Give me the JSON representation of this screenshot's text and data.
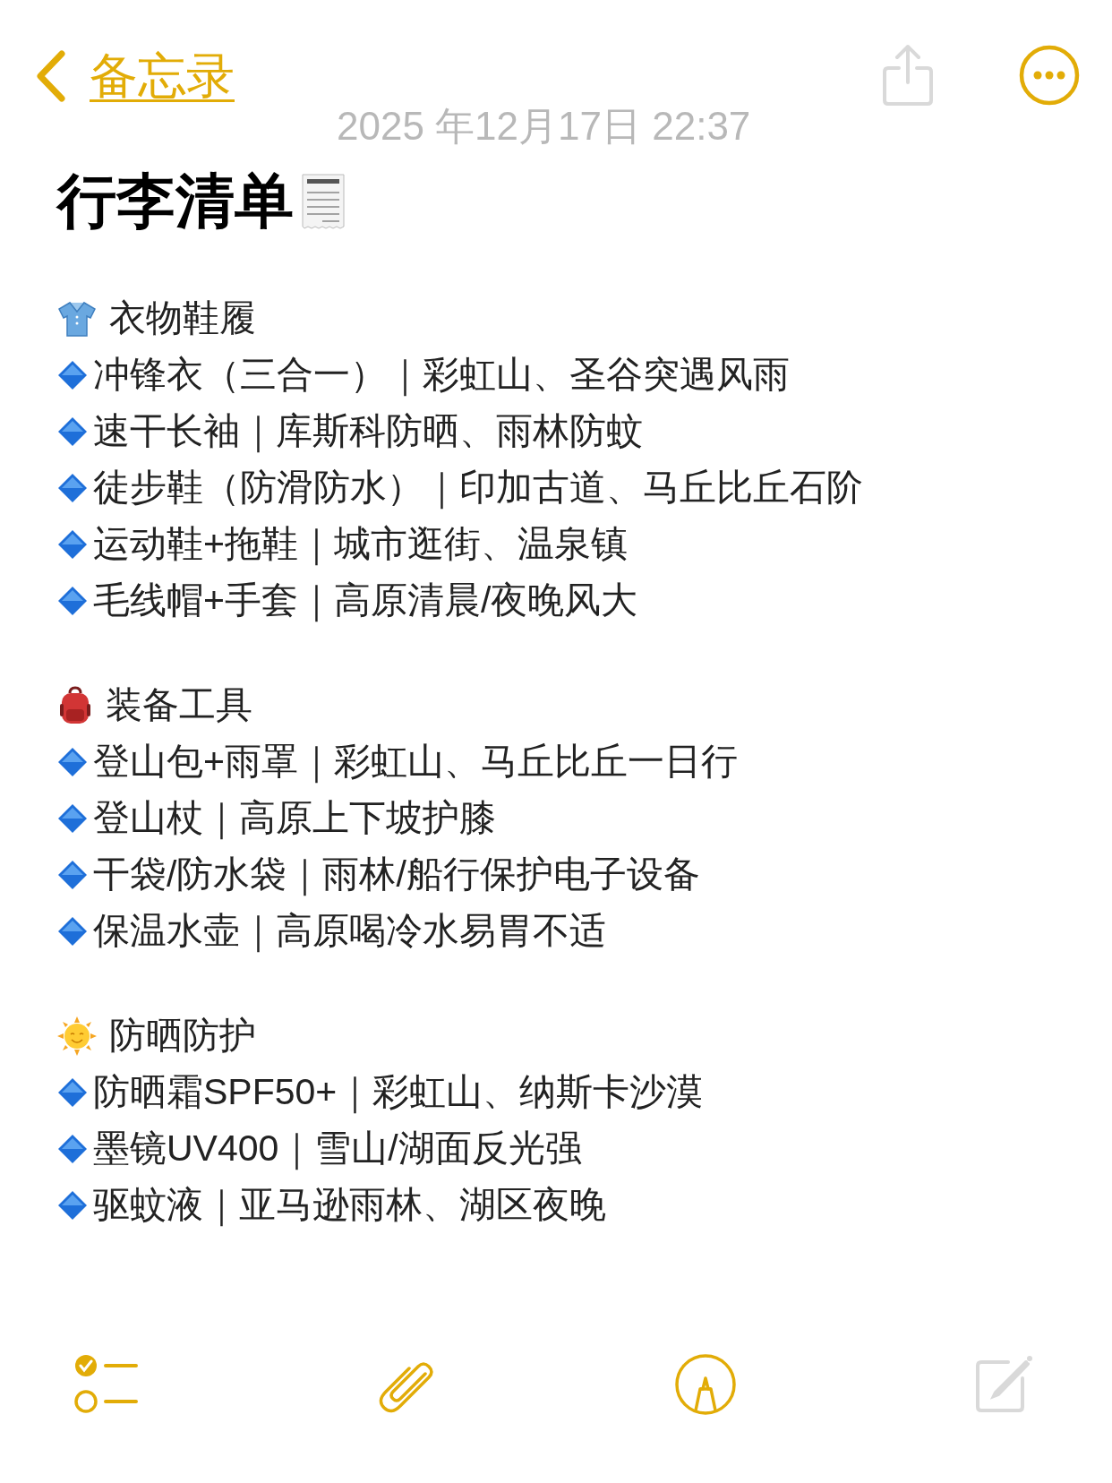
{
  "nav": {
    "back_label": "备忘录",
    "share_disabled": true
  },
  "date": "2025 年12月17日 22:37",
  "title": "行李清单",
  "sections": [
    {
      "heading": "衣物鞋履",
      "items": [
        "冲锋衣（三合一）｜彩虹山、圣谷突遇风雨",
        "速干长袖｜库斯科防晒、雨林防蚊",
        "徒步鞋（防滑防水）｜印加古道、马丘比丘石阶",
        "运动鞋+拖鞋｜城市逛街、温泉镇",
        "毛线帽+手套｜高原清晨/夜晚风大"
      ]
    },
    {
      "heading": "装备工具",
      "items": [
        "登山包+雨罩｜彩虹山、马丘比丘一日行",
        "登山杖｜高原上下坡护膝",
        "干袋/防水袋｜雨林/船行保护电子设备",
        "保温水壶｜高原喝冷水易胃不适"
      ]
    },
    {
      "heading": "防晒防护",
      "items": [
        "防晒霜SPF50+｜彩虹山、纳斯卡沙漠",
        "墨镜UV400｜雪山/湖面反光强",
        "驱蚊液｜亚马逊雨林、湖区夜晚"
      ]
    }
  ],
  "toolbar": {
    "compose_disabled": true
  }
}
